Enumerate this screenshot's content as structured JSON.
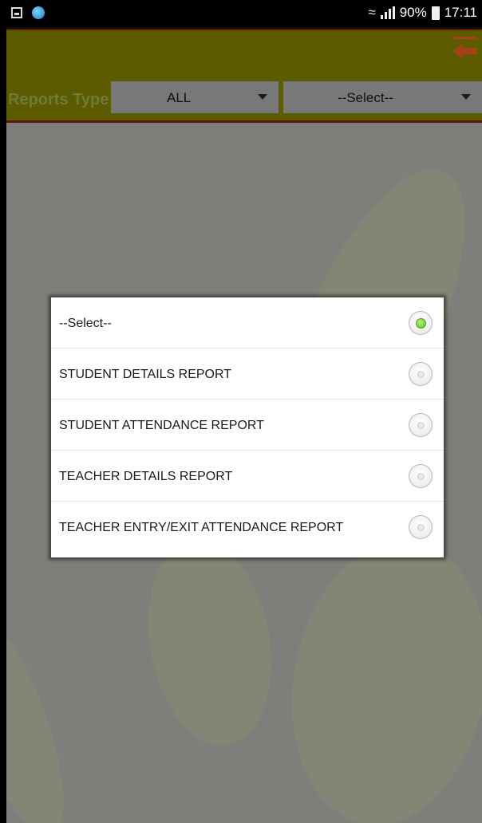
{
  "status_bar": {
    "left_icons": [
      "gallery-icon",
      "app-icon"
    ],
    "wifi_icon": "wifi-icon",
    "signal_icon": "signal-icon",
    "battery_percent": "90%",
    "time": "17:11"
  },
  "header": {
    "back_icon": "back-arrow-icon",
    "reports_type_label": "Reports Type",
    "type_dropdown_value": "ALL",
    "report_dropdown_value": "--Select--"
  },
  "dialog": {
    "options": [
      {
        "label": "--Select--",
        "selected": true
      },
      {
        "label": "STUDENT DETAILS REPORT",
        "selected": false
      },
      {
        "label": "STUDENT ATTENDANCE REPORT",
        "selected": false
      },
      {
        "label": "TEACHER DETAILS REPORT",
        "selected": false
      },
      {
        "label": "TEACHER ENTRY/EXIT ATTENDANCE REPORT",
        "selected": false
      }
    ]
  },
  "colors": {
    "header_bg": "#5d5b00",
    "header_border": "#5a1a00",
    "back_arrow": "#a8401c",
    "selected_radio": "#5fbf1f"
  }
}
